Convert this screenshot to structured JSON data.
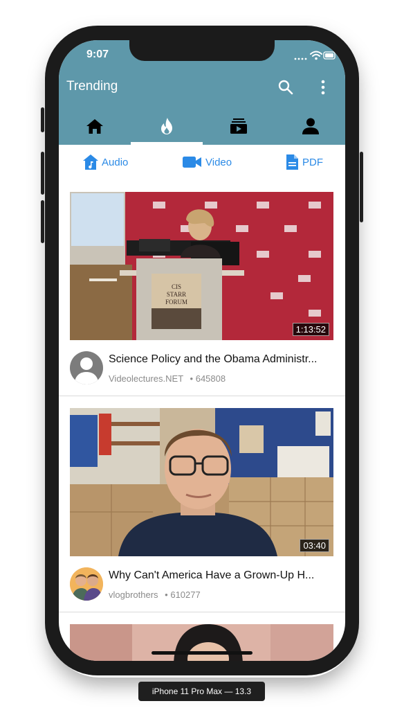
{
  "status_bar": {
    "time": "9:07"
  },
  "header": {
    "title": "Trending"
  },
  "filters": [
    {
      "label": "Audio"
    },
    {
      "label": "Video"
    },
    {
      "label": "PDF"
    }
  ],
  "videos": [
    {
      "title": "Science Policy and the Obama Administr...",
      "channel": "Videolectures.NET",
      "views": "• 645808",
      "duration": "1:13:52",
      "podium_text": "CIS STARR FORUM"
    },
    {
      "title": "Why Can't America Have a Grown-Up H...",
      "channel": "vlogbrothers",
      "views": "• 610277",
      "duration": "03:40"
    },
    {
      "title": "",
      "channel": "",
      "views": "",
      "duration": ""
    }
  ],
  "device_label": "iPhone 11 Pro Max — 13.3",
  "colors": {
    "appbar": "#5e98aa",
    "accent": "#2b8ae6"
  }
}
